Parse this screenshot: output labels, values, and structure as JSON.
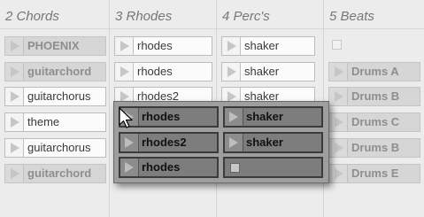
{
  "tracks": [
    {
      "title": "2 Chords",
      "slots": [
        {
          "label": "PHOENIX",
          "state": "filled"
        },
        {
          "label": "guitarchord",
          "state": "filled"
        },
        {
          "label": "guitarchorus",
          "state": "clip"
        },
        {
          "label": "theme",
          "state": "clip"
        },
        {
          "label": "guitarchorus",
          "state": "clip"
        },
        {
          "label": "guitarchord",
          "state": "filled"
        }
      ]
    },
    {
      "title": "3 Rhodes",
      "slots": [
        {
          "label": "rhodes",
          "state": "clip"
        },
        {
          "label": "rhodes",
          "state": "clip"
        },
        {
          "label": "rhodes2",
          "state": "clip"
        }
      ]
    },
    {
      "title": "4 Perc's",
      "slots": [
        {
          "label": "shaker",
          "state": "clip"
        },
        {
          "label": "shaker",
          "state": "clip"
        },
        {
          "label": "shaker",
          "state": "clip"
        }
      ]
    },
    {
      "title": "5 Beats",
      "slots": [
        {
          "label": "",
          "state": "stop"
        },
        {
          "label": "Drums A",
          "state": "filled"
        },
        {
          "label": "Drums B",
          "state": "filled"
        },
        {
          "label": "Drums C",
          "state": "filled"
        },
        {
          "label": "Drums B",
          "state": "filled"
        },
        {
          "label": "Drums E",
          "state": "filled"
        }
      ]
    }
  ],
  "drag_popup": {
    "left_column": [
      {
        "label": "rhodes"
      },
      {
        "label": "rhodes2"
      },
      {
        "label": "rhodes"
      }
    ],
    "right_column": [
      {
        "label": "shaker"
      },
      {
        "label": "shaker"
      },
      {
        "label": ""
      }
    ]
  },
  "icons": {
    "play": "play-triangle-icon",
    "stop": "stop-square-icon",
    "cursor": "arrow-cursor-icon"
  },
  "colors": {
    "background": "#ececec",
    "popup_background": "#9e9e9e",
    "popup_slot": "#7d7d7d"
  }
}
